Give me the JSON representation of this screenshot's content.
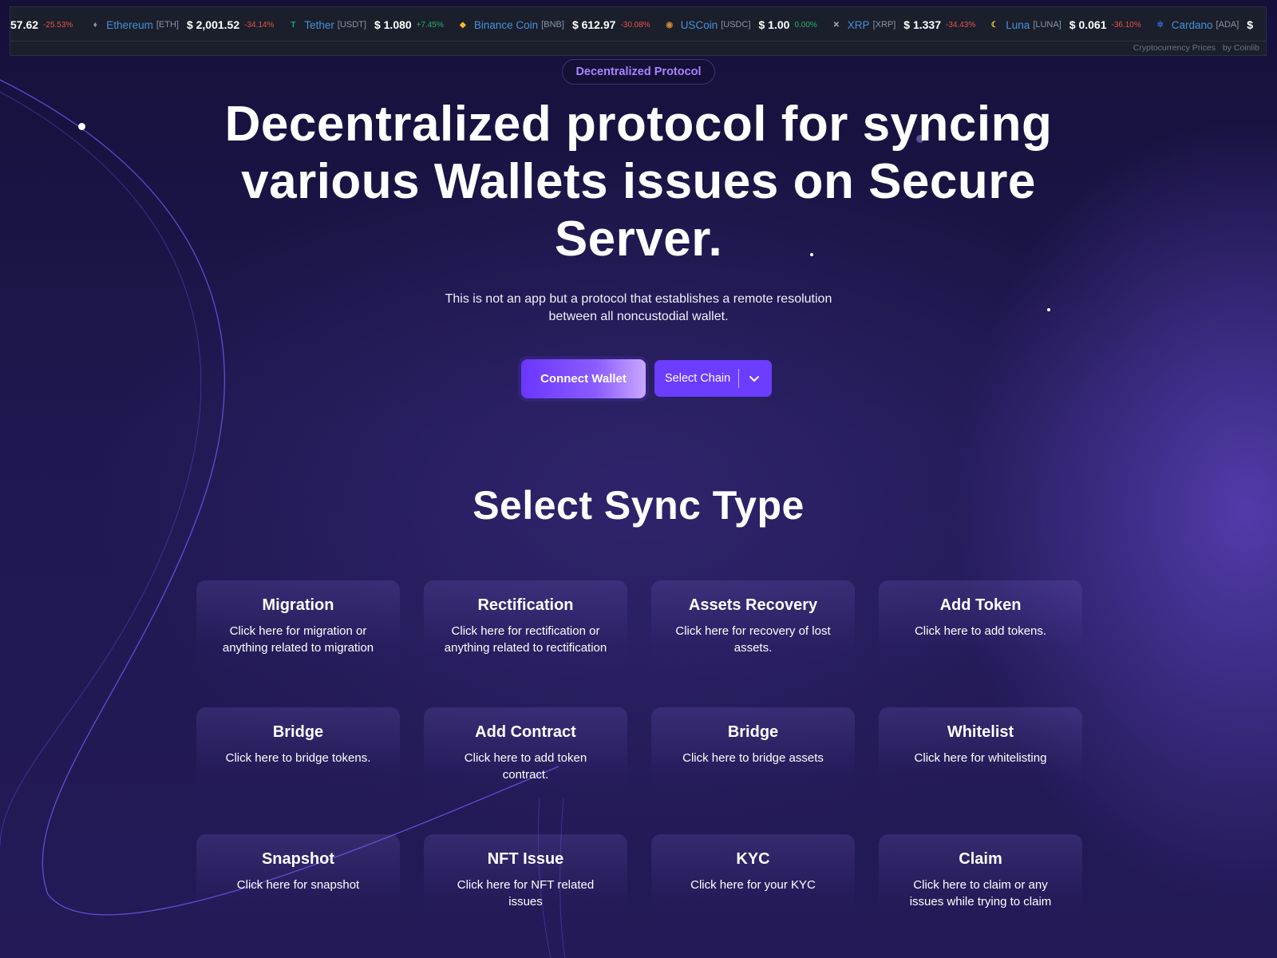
{
  "ticker": {
    "lead_price": "57.62",
    "lead_change": "-25.53%",
    "items": [
      {
        "name": "Ethereum",
        "symbol": "[ETH]",
        "price": "$ 2,001.52",
        "change": "-34.14%",
        "trend": "neg",
        "icon": "ethereum-icon",
        "icon_color": "#8a93a6",
        "glyph": "♦"
      },
      {
        "name": "Tether",
        "symbol": "[USDT]",
        "price": "$ 1.080",
        "change": "+7.45%",
        "trend": "pos",
        "icon": "tether-icon",
        "icon_color": "#26a17b",
        "glyph": "T"
      },
      {
        "name": "Binance Coin",
        "symbol": "[BNB]",
        "price": "$ 612.97",
        "change": "-30.08%",
        "trend": "neg",
        "icon": "binance-coin-icon",
        "icon_color": "#f3ba2f",
        "glyph": "◆"
      },
      {
        "name": "USCoin",
        "symbol": "[USDC]",
        "price": "$ 1.00",
        "change": "0.00%",
        "trend": "neu",
        "icon": "uscoin-icon",
        "icon_color": "#c98a3a",
        "glyph": "◉"
      },
      {
        "name": "XRP",
        "symbol": "[XRP]",
        "price": "$ 1.337",
        "change": "-34.43%",
        "trend": "neg",
        "icon": "xrp-icon",
        "icon_color": "#aab2c0",
        "glyph": "✕"
      },
      {
        "name": "Luna",
        "symbol": "[LUNA]",
        "price": "$ 0.061",
        "change": "-36.10%",
        "trend": "neg",
        "icon": "luna-icon",
        "icon_color": "#ffd83d",
        "glyph": "☾"
      },
      {
        "name": "Cardano",
        "symbol": "[ADA]",
        "price": "$",
        "change": "",
        "trend": "neg",
        "icon": "cardano-icon",
        "icon_color": "#3468d1",
        "glyph": "✲"
      }
    ],
    "footer_label": "Cryptocurrency Prices",
    "footer_by": "by Coinlib"
  },
  "hero": {
    "badge": "Decentralized Protocol",
    "title": "Decentralized protocol for syncing various Wallets issues on Secure Server.",
    "subtitle": "This is not an app but a protocol that establishes a remote resolution between all noncustodial wallet.",
    "connect_label": "Connect Wallet",
    "chain_label": "Select Chain"
  },
  "sync": {
    "title": "Select Sync Type",
    "cards": [
      {
        "title": "Migration",
        "desc": "Click here for migration or anything related to migration"
      },
      {
        "title": "Rectification",
        "desc": "Click here for rectification or anything related to rectification"
      },
      {
        "title": "Assets Recovery",
        "desc": "Click here for recovery of lost assets."
      },
      {
        "title": "Add Token",
        "desc": "Click here to add tokens."
      },
      {
        "title": "Bridge",
        "desc": "Click here to bridge tokens."
      },
      {
        "title": "Add Contract",
        "desc": "Click here to add token contract."
      },
      {
        "title": "Bridge",
        "desc": "Click here to bridge assets"
      },
      {
        "title": "Whitelist",
        "desc": "Click here for whitelisting"
      },
      {
        "title": "Snapshot",
        "desc": "Click here for snapshot"
      },
      {
        "title": "NFT Issue",
        "desc": "Click here for NFT related issues"
      },
      {
        "title": "KYC",
        "desc": "Click here for your KYC"
      },
      {
        "title": "Claim",
        "desc": "Click here to claim or any issues while trying to claim"
      }
    ]
  }
}
